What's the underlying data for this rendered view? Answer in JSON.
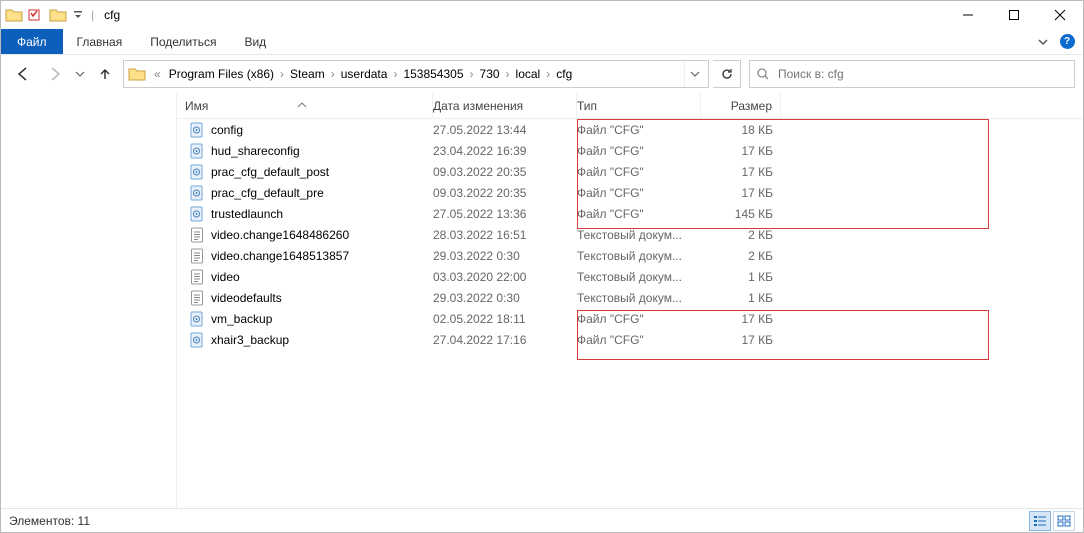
{
  "titlebar": {
    "app_title": "cfg"
  },
  "ribbon": {
    "file_label": "Файл",
    "tabs": [
      "Главная",
      "Поделиться",
      "Вид"
    ]
  },
  "address": {
    "prefix": "«",
    "crumbs": [
      "Program Files (x86)",
      "Steam",
      "userdata",
      "153854305",
      "730",
      "local",
      "cfg"
    ]
  },
  "search": {
    "placeholder": "Поиск в: cfg"
  },
  "columns": {
    "name": "Имя",
    "date": "Дата изменения",
    "type": "Тип",
    "size": "Размер"
  },
  "files": [
    {
      "icon": "cfg",
      "name": "config",
      "date": "27.05.2022 13:44",
      "type": "Файл \"CFG\"",
      "size": "18 КБ"
    },
    {
      "icon": "cfg",
      "name": "hud_shareconfig",
      "date": "23.04.2022 16:39",
      "type": "Файл \"CFG\"",
      "size": "17 КБ"
    },
    {
      "icon": "cfg",
      "name": "prac_cfg_default_post",
      "date": "09.03.2022 20:35",
      "type": "Файл \"CFG\"",
      "size": "17 КБ"
    },
    {
      "icon": "cfg",
      "name": "prac_cfg_default_pre",
      "date": "09.03.2022 20:35",
      "type": "Файл \"CFG\"",
      "size": "17 КБ"
    },
    {
      "icon": "cfg",
      "name": "trustedlaunch",
      "date": "27.05.2022 13:36",
      "type": "Файл \"CFG\"",
      "size": "145 КБ"
    },
    {
      "icon": "txt",
      "name": "video.change1648486260",
      "date": "28.03.2022 16:51",
      "type": "Текстовый докум...",
      "size": "2 КБ"
    },
    {
      "icon": "txt",
      "name": "video.change1648513857",
      "date": "29.03.2022 0:30",
      "type": "Текстовый докум...",
      "size": "2 КБ"
    },
    {
      "icon": "txt",
      "name": "video",
      "date": "03.03.2020 22:00",
      "type": "Текстовый докум...",
      "size": "1 КБ"
    },
    {
      "icon": "txt",
      "name": "videodefaults",
      "date": "29.03.2022 0:30",
      "type": "Текстовый докум...",
      "size": "1 КБ"
    },
    {
      "icon": "cfg",
      "name": "vm_backup",
      "date": "02.05.2022 18:11",
      "type": "Файл \"CFG\"",
      "size": "17 КБ"
    },
    {
      "icon": "cfg",
      "name": "xhair3_backup",
      "date": "27.04.2022 17:16",
      "type": "Файл \"CFG\"",
      "size": "17 КБ"
    }
  ],
  "status": {
    "count_label": "Элементов: 11"
  }
}
